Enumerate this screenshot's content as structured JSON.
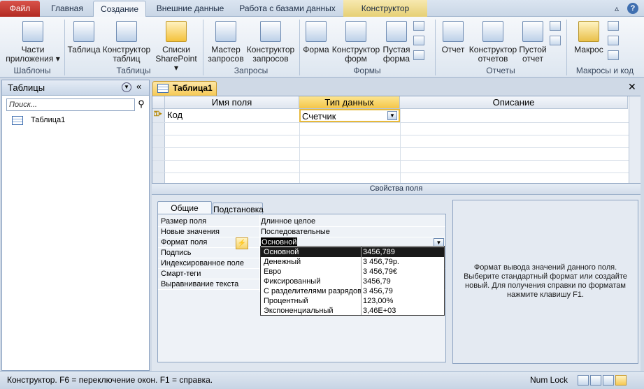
{
  "ribbon_tabs": [
    "Файл",
    "Главная",
    "Создание",
    "Внешние данные",
    "Работа с базами данных",
    "Конструктор"
  ],
  "window_controls": {
    "collapse": "▵",
    "help": "?"
  },
  "ribbon": {
    "templates": {
      "btn": "Части приложения ▾",
      "group": "Шаблоны"
    },
    "tables": {
      "table": "Таблица",
      "designer": "Конструктор таблиц",
      "sharepoint": "Списки SharePoint ▾",
      "group": "Таблицы"
    },
    "queries": {
      "wizard": "Мастер запросов",
      "designer": "Конструктор запросов",
      "group": "Запросы"
    },
    "forms": {
      "form": "Форма",
      "designer": "Конструктор форм",
      "blank": "Пустая форма",
      "group": "Формы"
    },
    "reports": {
      "report": "Отчет",
      "designer": "Конструктор отчетов",
      "blank": "Пустой отчет",
      "group": "Отчеты"
    },
    "macros": {
      "macro": "Макрос",
      "group": "Макросы и код"
    }
  },
  "nav": {
    "title": "Таблицы",
    "search_placeholder": "Поиск...",
    "items": [
      "Таблица1"
    ]
  },
  "doc_tab": "Таблица1",
  "grid": {
    "headers": [
      "Имя поля",
      "Тип данных",
      "Описание"
    ],
    "row": {
      "name": "Код",
      "type": "Счетчик"
    }
  },
  "props_label": "Свойства поля",
  "prop_tabs": [
    "Общие",
    "Подстановка"
  ],
  "props": [
    {
      "label": "Размер поля",
      "value": "Длинное целое"
    },
    {
      "label": "Новые значения",
      "value": "Последовательные"
    },
    {
      "label": "Формат поля",
      "value": "Основной"
    },
    {
      "label": "Подпись",
      "value": ""
    },
    {
      "label": "Индексированное поле",
      "value": ""
    },
    {
      "label": "Смарт-теги",
      "value": ""
    },
    {
      "label": "Выравнивание текста",
      "value": ""
    }
  ],
  "format_options": [
    {
      "name": "Основной",
      "sample": "3456,789"
    },
    {
      "name": "Денежный",
      "sample": "3 456,79р."
    },
    {
      "name": "Евро",
      "sample": "3 456,79€"
    },
    {
      "name": "Фиксированный",
      "sample": "3456,79"
    },
    {
      "name": "С разделителями разрядов",
      "sample": "3 456,79"
    },
    {
      "name": "Процентный",
      "sample": "123,00%"
    },
    {
      "name": "Экспоненциальный",
      "sample": "3,46E+03"
    }
  ],
  "help_text": "Формат вывода значений данного поля. Выберите стандартный формат или создайте новый. Для получения справки по форматам нажмите клавишу F1.",
  "status": {
    "left": "Конструктор.  F6 = переключение окон.  F1 = справка.",
    "numlock": "Num Lock"
  }
}
